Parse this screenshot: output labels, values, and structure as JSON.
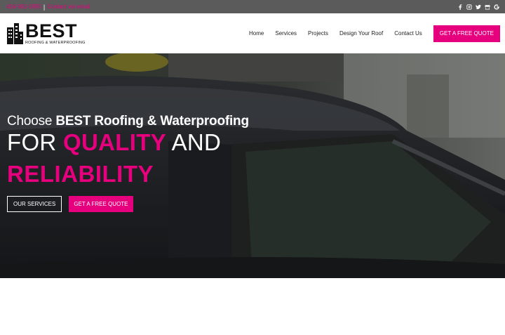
{
  "topbar": {
    "phone": "416-901-5955",
    "separator": "|",
    "email": "Contact via email"
  },
  "social_icons": [
    "facebook-icon",
    "instagram-icon",
    "twitter-icon",
    "gmb-icon",
    "google-icon"
  ],
  "header": {
    "brand": "BEST",
    "tagline": "ROOFING & WATERPROOFING",
    "nav": {
      "home": "Home",
      "services": "Services",
      "projects": "Projects",
      "design": "Design Your Roof",
      "contact": "Contact Us"
    },
    "quote_button": "GET A FREE QUOTE"
  },
  "hero": {
    "line1_prefix": "Choose ",
    "line1_bold": "BEST Roofing & Waterproofing",
    "line2_pre": "FOR ",
    "line2_accent": "QUALITY",
    "line2_post": " AND",
    "line3": "RELIABILITY",
    "services_button": "OUR SERVICES",
    "quote_button": "GET A FREE QUOTE"
  },
  "colors": {
    "accent": "#e6007e",
    "topbar": "#5b5b5b",
    "hero_overlay": "#2b2e2c"
  }
}
